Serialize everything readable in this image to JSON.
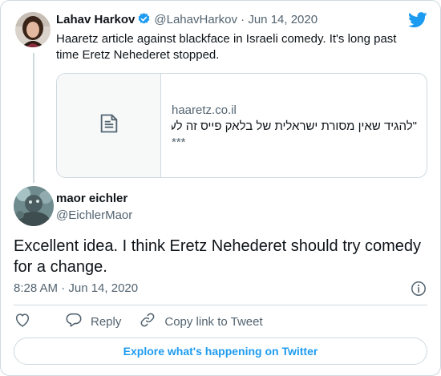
{
  "colors": {
    "accent": "#1d9bf0",
    "text_primary": "#0f1419",
    "text_secondary": "#536471",
    "border": "#cfd9de"
  },
  "parent_tweet": {
    "author_name": "Lahav Harkov",
    "handle": "@LahavHarkov",
    "separator": "·",
    "date": "Jun 14, 2020",
    "verified_icon": "verified-badge-icon",
    "text": "Haaretz article against blackface in Israeli comedy. It's long past time Eretz Nehederet stopped.",
    "link_card": {
      "thumbnail_icon": "document-icon",
      "domain": "haaretz.co.il",
      "title": "\"להגיד שאין מסורת ישראלית של בלאק פייס זה לע…",
      "description": "***"
    }
  },
  "reply_tweet": {
    "author_name": "maor eichler",
    "handle": "@EichlerMaor",
    "text": "Excellent idea. I think Eretz Nehederet should try comedy for a change.",
    "timestamp": "8:28 AM · Jun 14, 2020",
    "info_icon": "info-icon"
  },
  "actions": {
    "like_icon": "heart-icon",
    "reply_label": "Reply",
    "copy_link_label": "Copy link to Tweet"
  },
  "explore_button": {
    "label": "Explore what's happening on Twitter"
  },
  "brand_icon": "twitter-bird-icon"
}
